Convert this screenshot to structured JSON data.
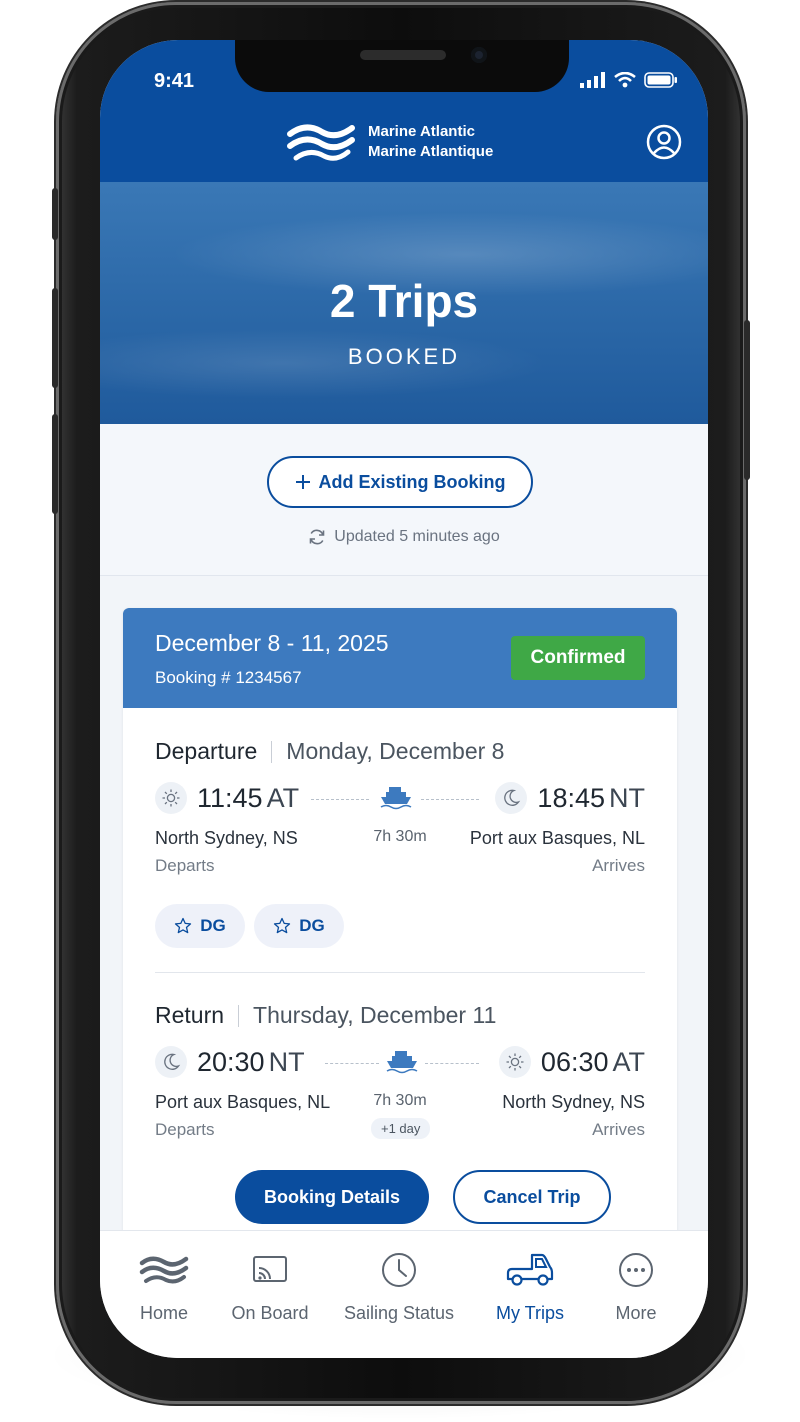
{
  "status_bar": {
    "time": "9:41"
  },
  "header": {
    "logo_line1": "Marine Atlantic",
    "logo_line2": "Marine Atlantique"
  },
  "hero": {
    "count_label": "2 Trips",
    "subtitle": "BOOKED"
  },
  "actions": {
    "add_booking_label": "Add Existing Booking",
    "updated_text": "Updated 5 minutes ago"
  },
  "booking": {
    "date_range": "December 8 - 11, 2025",
    "booking_number": "Booking # 1234567",
    "status": "Confirmed",
    "status_color": "#3fa846",
    "departure": {
      "title": "Departure",
      "day": "Monday, December 8",
      "depart_time": "11:45",
      "depart_tz": "AT",
      "arrive_time": "18:45",
      "arrive_tz": "NT",
      "duration": "7h 30m",
      "from_port": "North Sydney, NS",
      "to_port": "Port aux Basques, NL",
      "departs_label": "Departs",
      "arrives_label": "Arrives",
      "depart_icon": "sun-icon",
      "arrive_icon": "moon-icon",
      "tags": [
        "DG",
        "DG"
      ]
    },
    "return": {
      "title": "Return",
      "day": "Thursday, December 11",
      "depart_time": "20:30",
      "depart_tz": "NT",
      "arrive_time": "06:30",
      "arrive_tz": "AT",
      "duration": "7h 30m",
      "next_day": "+1 day",
      "from_port": "Port aux Basques, NL",
      "to_port": "North Sydney, NS",
      "departs_label": "Departs",
      "arrives_label": "Arrives",
      "depart_icon": "moon-icon",
      "arrive_icon": "sun-icon"
    },
    "details_button": "Booking Details",
    "cancel_button": "Cancel Trip"
  },
  "tabs": [
    {
      "label": "Home",
      "icon": "waves-icon",
      "active": false
    },
    {
      "label": "On Board",
      "icon": "cast-icon",
      "active": false
    },
    {
      "label": "Sailing Status",
      "icon": "clock-icon",
      "active": false
    },
    {
      "label": "My Trips",
      "icon": "truck-icon",
      "active": true
    },
    {
      "label": "More",
      "icon": "more-icon",
      "active": false
    }
  ],
  "colors": {
    "primary": "#0a4d9e",
    "card_header": "#3d7abf",
    "success": "#3fa846"
  }
}
